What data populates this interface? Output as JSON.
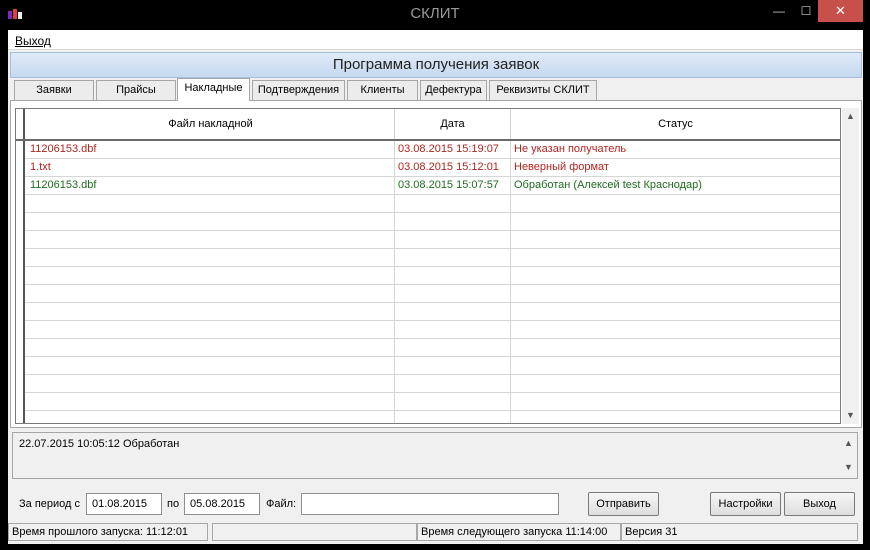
{
  "window": {
    "title": "СКЛИТ",
    "min_glyph": "—",
    "max_glyph": "☐",
    "close_glyph": "✕"
  },
  "menu": {
    "exit": "Выход"
  },
  "header": {
    "title": "Программа получения заявок"
  },
  "tabs": [
    {
      "label": "Заявки"
    },
    {
      "label": "Прайсы"
    },
    {
      "label": "Накладные",
      "active": true
    },
    {
      "label": "Подтверждения"
    },
    {
      "label": "Клиенты"
    },
    {
      "label": "Дефектура"
    },
    {
      "label": "Реквизиты СКЛИТ"
    }
  ],
  "grid": {
    "columns": [
      "Файл накладной",
      "Дата",
      "Статус"
    ],
    "rows": [
      {
        "file": "11206153.dbf",
        "date": "03.08.2015 15:19:07",
        "status": "Не указан получатель",
        "color": "#b0261e"
      },
      {
        "file": "1.txt",
        "date": "03.08.2015 15:12:01",
        "status": "Неверный формат",
        "color": "#b0261e"
      },
      {
        "file": "11206153.dbf",
        "date": "03.08.2015 15:07:57",
        "status": "Обработан (Алексей test Краснодар)",
        "color": "#1f6e1f"
      }
    ],
    "up_arrow": "▲",
    "down_arrow": "▼"
  },
  "log": {
    "text": "22.07.2015 10:05:12 Обработан"
  },
  "controls": {
    "period_label": "За период с",
    "date_from": "01.08.2015",
    "to_label": "по",
    "date_to": "05.08.2015",
    "file_label": "Файл:",
    "file_value": "",
    "send_button": "Отправить",
    "settings_button": "Настройки",
    "exit_button": "Выход"
  },
  "status": {
    "last_run": "Время прошлого запуска: 11:12:01",
    "next_run": "Время следующего запуска 11:14:00",
    "version": "Версия 31"
  }
}
